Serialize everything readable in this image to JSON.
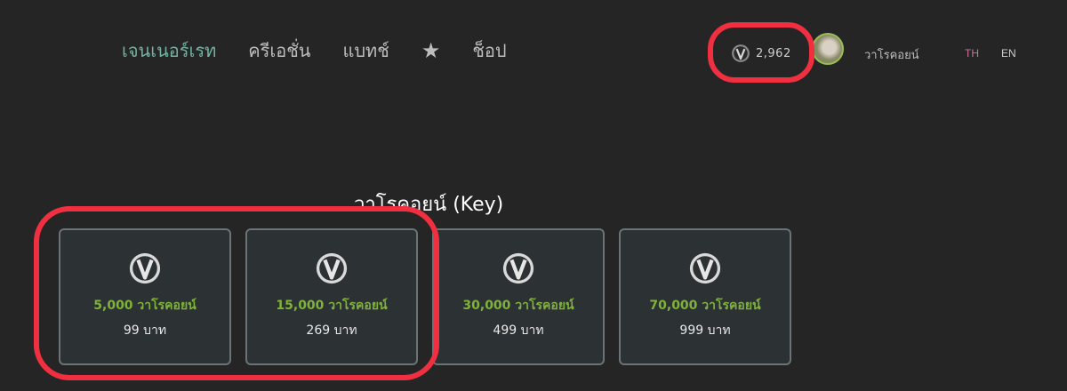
{
  "nav": {
    "items": [
      {
        "label": "เจนเนอร์เรท",
        "active": true
      },
      {
        "label": "ครีเอชั่น",
        "active": false
      },
      {
        "label": "แบทช์",
        "active": false
      },
      {
        "label": "★",
        "icon": "star-icon"
      },
      {
        "label": "ช็อป",
        "active": false
      }
    ]
  },
  "header": {
    "balance": "2,962",
    "balance_icon": "coin-icon",
    "username": "วาโรคอยน์",
    "lang_th": "TH",
    "lang_en": "EN",
    "active_lang_color": "#d0709a"
  },
  "shop": {
    "title": "วาโรคอยน์ (Key)",
    "packages": [
      {
        "amount": "5,000 วาโรคอยน์",
        "price": "99 บาท"
      },
      {
        "amount": "15,000 วาโรคอยน์",
        "price": "269 บาท"
      },
      {
        "amount": "30,000 วาโรคอยน์",
        "price": "499 บาท"
      },
      {
        "amount": "70,000 วาโรคอยน์",
        "price": "999 บาท"
      }
    ]
  },
  "colors": {
    "accent_nav": "#6fb3a0",
    "amount_green": "#7fb23a",
    "highlight_red": "#f03040"
  }
}
